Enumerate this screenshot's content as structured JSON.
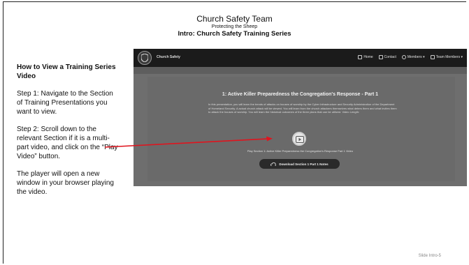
{
  "slide": {
    "title": "Church Safety Team",
    "subtitle": "Protecting the Sheep",
    "section": "Intro: Church Safety Training Series",
    "footer": "Slide Intro-5"
  },
  "instructions": {
    "heading": "How to View a Training Series Video",
    "step1": "Step 1: Navigate to the Section of Training Presentations you want to view.",
    "step2": "Step 2: Scroll down to the relevant Section if it is a multi-part video, and click on the “Play Video” button.",
    "step3": "The player will open a new window in your browser playing the video."
  },
  "site": {
    "brand": "Church Safety",
    "nav": {
      "home": "Home",
      "contact": "Contact",
      "members": "Members ▾",
      "team_members": "Team Members ▾"
    },
    "video": {
      "title": "1: Active Killer Preparedness the Congregation's Response - Part 1",
      "description": "In this presentation, you will learn the trends of attacks on houses of worship by the Cyber Infrastructure and Security Administration of the Department of Homeland Security. A actual church attack will be viewed. You will learn from the church attackers themselves what deters them and what invites them to attack the houses of worship. You will learn the historical outcomes of the three plans that can be utilized. Video Length:",
      "play_caption": "Play Section 1: Active Killer Preparedness the Congregation's Response Part 1 Video",
      "download_label": "Download Section 1 Part 1 Notes"
    }
  },
  "colors": {
    "arrow": "#e0141e",
    "nav_bg": "#1b1b1b",
    "content_bg": "#6e6e6e"
  }
}
